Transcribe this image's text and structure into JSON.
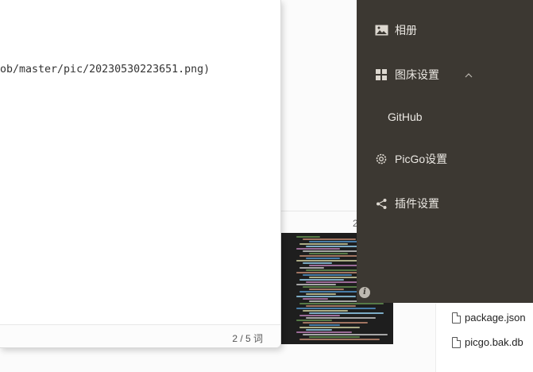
{
  "editor": {
    "content_line": "ob/master/pic/20230530223651.png)",
    "word_count": "2 / 5 词"
  },
  "background": {
    "fragment": "2",
    "files": [
      {
        "name": "package.json"
      },
      {
        "name": "picgo.bak.db"
      }
    ]
  },
  "sidebar": {
    "items": [
      {
        "label": "相册",
        "icon": "image-icon"
      },
      {
        "label": "图床设置",
        "icon": "grid-icon",
        "expanded": true,
        "chevron": "^"
      },
      {
        "label": "GitHub",
        "icon": null
      },
      {
        "label": "PicGo设置",
        "icon": "gear-icon"
      },
      {
        "label": "插件设置",
        "icon": "share-icon"
      }
    ],
    "info_glyph": "i"
  },
  "colors": {
    "sidebar_bg": "#3c3832",
    "sidebar_text": "#ebe8e3",
    "editor_bg": "#ffffff"
  }
}
